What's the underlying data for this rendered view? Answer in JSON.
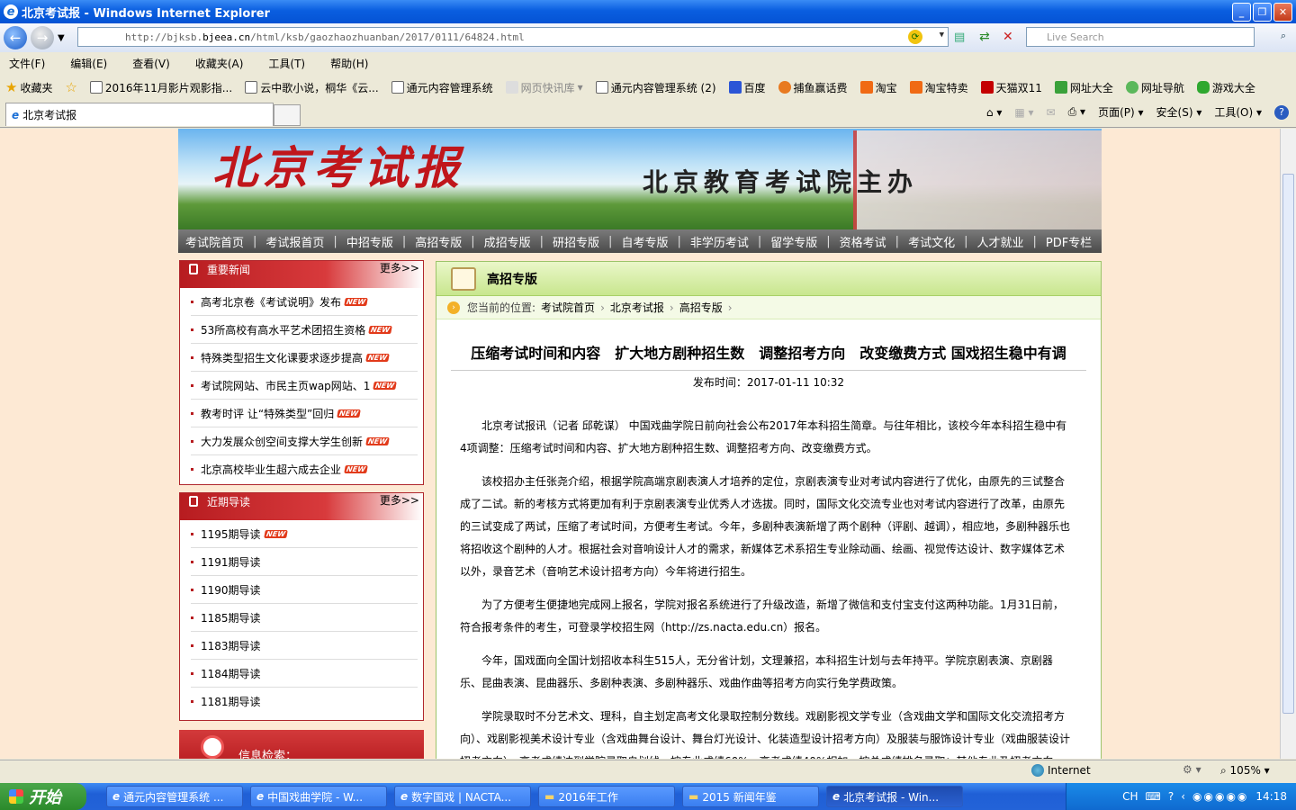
{
  "window": {
    "title": "北京考试报 - Windows Internet Explorer"
  },
  "address": {
    "prefix": "http://bjksb.",
    "domain": "bjeea.cn",
    "path": "/html/ksb/gaozhaozhuanban/2017/0111/64824.html",
    "search_placeholder": "Live Search"
  },
  "menu": [
    "文件(F)",
    "编辑(E)",
    "查看(V)",
    "收藏夹(A)",
    "工具(T)",
    "帮助(H)"
  ],
  "favorites": {
    "label": "收藏夹",
    "items": [
      "2016年11月影片观影指...",
      "云中歌小说，桐华《云...",
      "通元内容管理系统",
      "网页快讯库",
      "通元内容管理系统 (2)",
      "百度",
      "捕鱼赢话费",
      "淘宝",
      "淘宝特卖",
      "天猫双11",
      "网址大全",
      "网址导航",
      "游戏大全"
    ]
  },
  "tab": {
    "label": "北京考试报"
  },
  "cmdbar": {
    "page": "页面(P)",
    "safety": "安全(S)",
    "tools": "工具(O)"
  },
  "banner": {
    "logo": "北京考试报",
    "sponsor": "北京教育考试院主办"
  },
  "nav": [
    "考试院首页",
    "考试报首页",
    "中招专版",
    "高招专版",
    "成招专版",
    "研招专版",
    "自考专版",
    "非学历考试",
    "留学专版",
    "资格考试",
    "考试文化",
    "人才就业",
    "PDF专栏"
  ],
  "news": {
    "title": "重要新闻",
    "more": "更多>>",
    "items": [
      "高考北京卷《考试说明》发布",
      "53所高校有高水平艺术团招生资格",
      "特殊类型招生文化课要求逐步提高",
      "考试院网站、市民主页wap网站、1",
      "教考时评 让“特殊类型”回归",
      "大力发展众创空间支撑大学生创新",
      "北京高校毕业生超六成去企业"
    ]
  },
  "guide": {
    "title": "近期导读",
    "more": "更多>>",
    "items": [
      "1195期导读",
      "1191期导读",
      "1190期导读",
      "1185期导读",
      "1183期导读",
      "1184期导读",
      "1181期导读"
    ]
  },
  "info_search": {
    "title": "信息检索："
  },
  "section": {
    "title": "高招专版"
  },
  "crumb": {
    "label": "您当前的位置:",
    "items": [
      "考试院首页",
      "北京考试报",
      "高招专版"
    ]
  },
  "article": {
    "title": "压缩考试时间和内容　扩大地方剧种招生数　调整招考方向　改变缴费方式 国戏招生稳中有调",
    "pubtime": "发布时间：2017-01-11 10:32",
    "paragraphs": [
      "北京考试报讯（记者 邱乾谋） 中国戏曲学院日前向社会公布2017年本科招生简章。与往年相比，该校今年本科招生稳中有4项调整：压缩考试时间和内容、扩大地方剧种招生数、调整招考方向、改变缴费方式。",
      "该校招办主任张尧介绍，根据学院高端京剧表演人才培养的定位，京剧表演专业对考试内容进行了优化，由原先的三试整合成了二试。新的考核方式将更加有利于京剧表演专业优秀人才选拔。同时，国际文化交流专业也对考试内容进行了改革，由原先的三试变成了两试，压缩了考试时间，方便考生考试。今年，多剧种表演新增了两个剧种（评剧、越调），相应地，多剧种器乐也将招收这个剧种的人才。根据社会对音响设计人才的需求，新媒体艺术系招生专业除动画、绘画、视觉传达设计、数字媒体艺术以外，录音艺术（音响艺术设计招考方向）今年将进行招生。",
      "为了方便考生便捷地完成网上报名，学院对报名系统进行了升级改造，新增了微信和支付宝支付这两种功能。1月31日前，符合报考条件的考生，可登录学校招生网（http://zs.nacta.edu.cn）报名。",
      "今年，国戏面向全国计划招收本科生515人，无分省计划，文理兼招，本科招生计划与去年持平。学院京剧表演、京剧器乐、昆曲表演、昆曲器乐、多剧种表演、多剧种器乐、戏曲作曲等招考方向实行免学费政策。",
      "学院录取时不分艺术文、理科，自主划定高考文化录取控制分数线。戏剧影视文学专业（含戏曲文学和国际文化交流招考方向）、戏剧影视美术设计专业（含戏曲舞台设计、舞台灯光设计、化装造型设计招考方向）及服装与服饰设计专业（戏曲服装设计招考方向），高考成绩达到学院录取自划线，按专业成绩60%、高考成绩40%相加，按总成绩排名录取；其他专业及招考方向，高"
    ]
  },
  "status": {
    "zone": "Internet",
    "zoom": "105%"
  },
  "taskbar": {
    "start": "开始",
    "items": [
      "通元内容管理系统 ...",
      "中国戏曲学院 - W...",
      "数字国戏 | NACTA...",
      "2016年工作",
      "2015 新闻年鉴",
      "北京考试报 - Win..."
    ],
    "lang": "CH",
    "clock": "14:18"
  }
}
